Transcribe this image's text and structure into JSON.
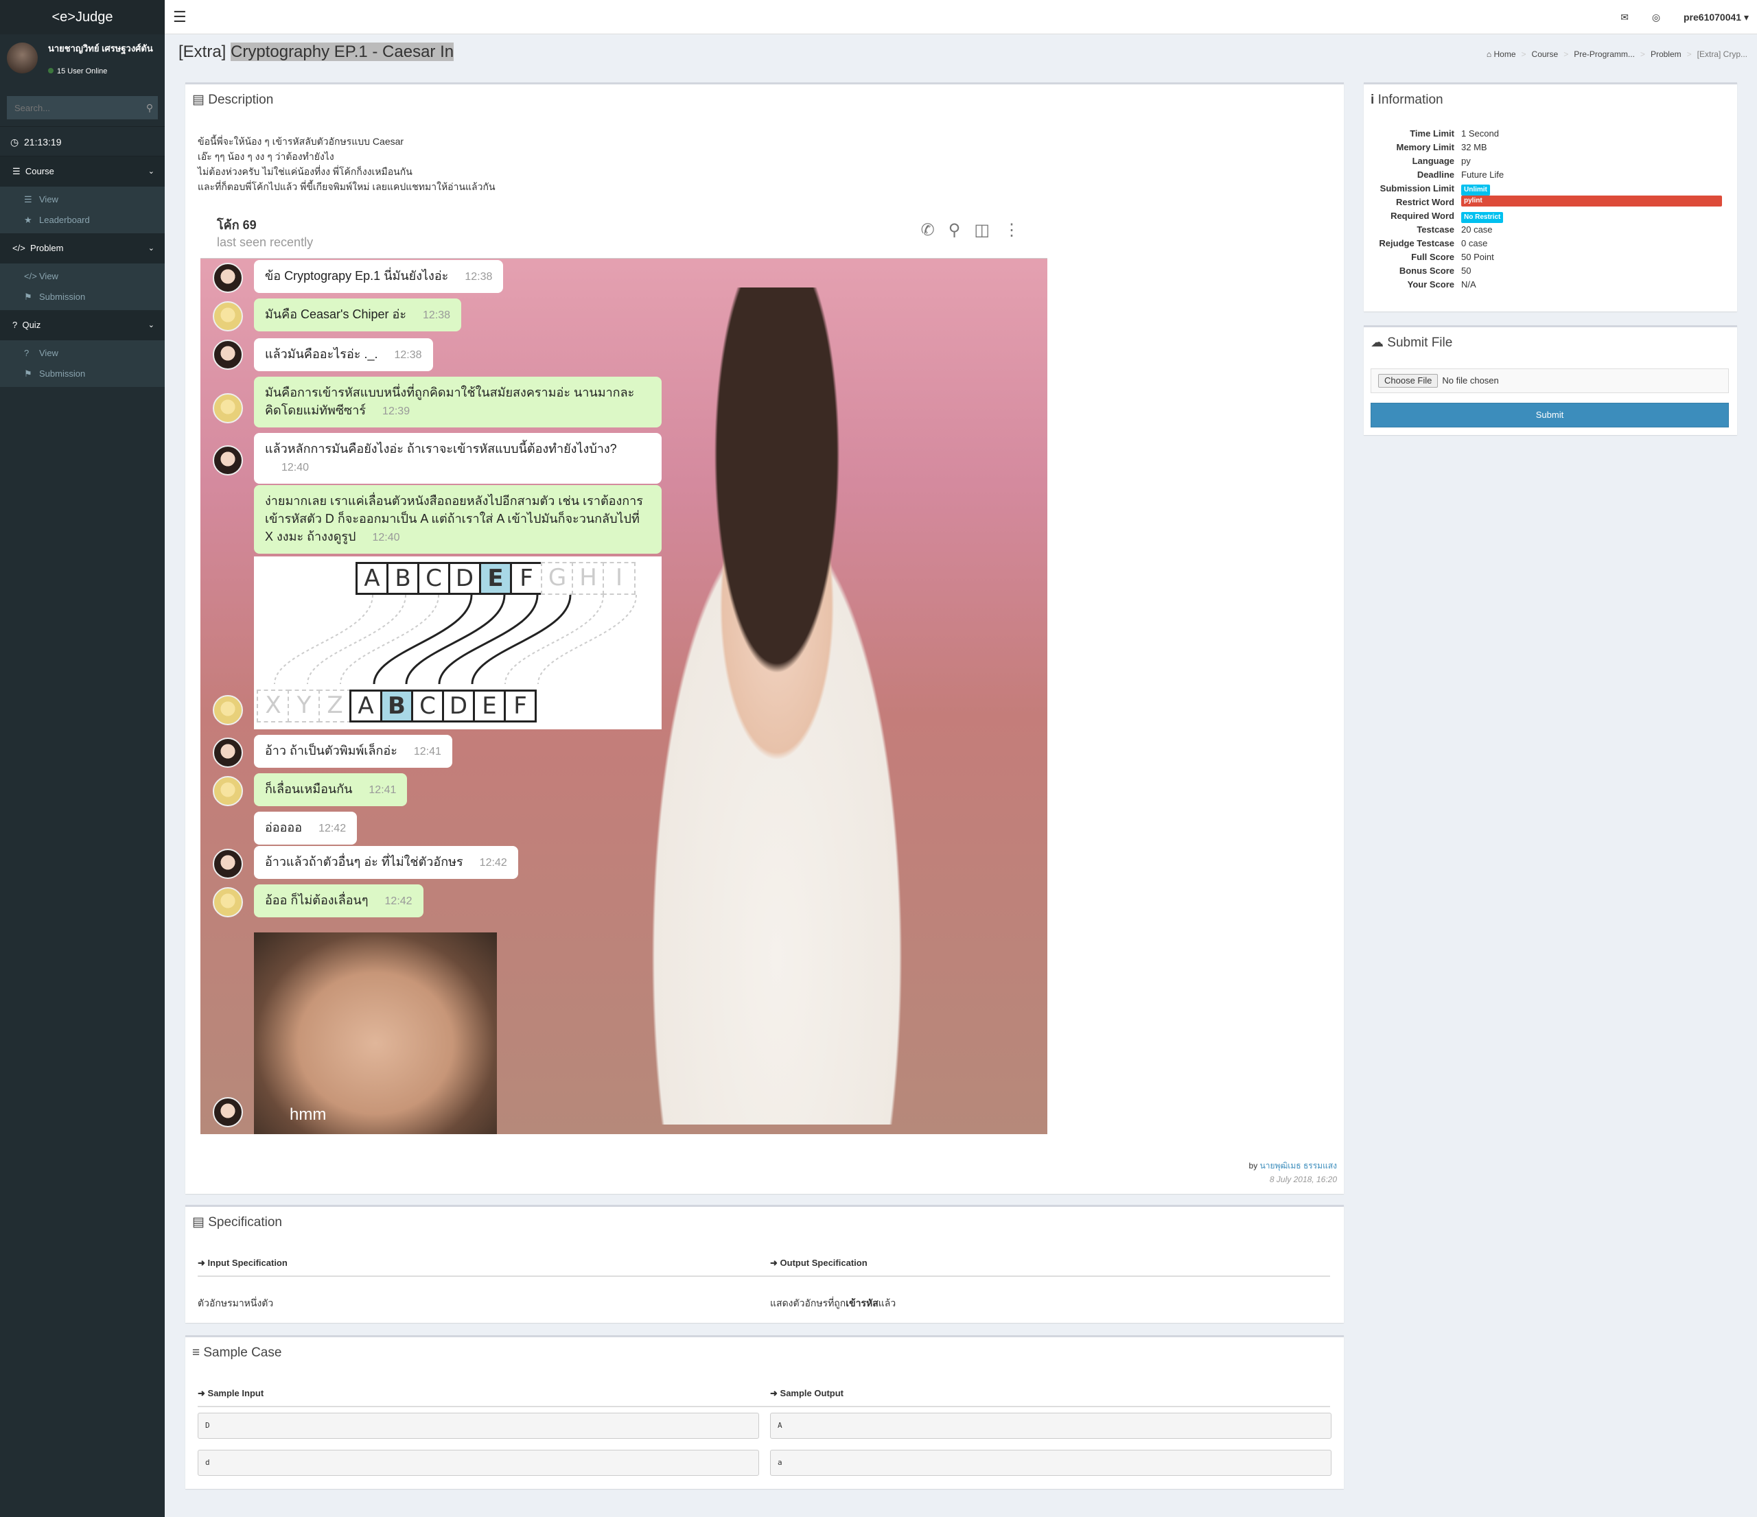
{
  "app": {
    "logo": "<e>Judge"
  },
  "user": {
    "name": "นายชาญวิทย์ เศรษฐวงศ์ตัน",
    "online": "15 User Online",
    "username": "pre61070041"
  },
  "search": {
    "placeholder": "Search..."
  },
  "clock": "21:13:19",
  "menu": {
    "course": {
      "label": "Course",
      "items": [
        {
          "icon": "list-icon",
          "label": "View"
        },
        {
          "icon": "trophy-icon",
          "label": "Leaderboard"
        }
      ]
    },
    "problem": {
      "label": "Problem",
      "items": [
        {
          "icon": "code-icon",
          "label": "View"
        },
        {
          "icon": "flag-icon",
          "label": "Submission"
        }
      ]
    },
    "quiz": {
      "label": "Quiz",
      "items": [
        {
          "icon": "question-icon",
          "label": "View"
        },
        {
          "icon": "flag-icon",
          "label": "Submission"
        }
      ]
    }
  },
  "page": {
    "prefix": "[Extra]",
    "title": "Cryptography EP.1 - Caesar In"
  },
  "breadcrumb": [
    "Home",
    "Course",
    "Pre-Programm...",
    "Problem",
    "[Extra] Cryp..."
  ],
  "description": {
    "heading": "Description",
    "lines": [
      "ข้อนี้พี่จะให้น้อง ๆ เข้ารหัสลับตัวอักษรแบบ Caesar",
      "เอ๊ะ ๆๆ น้อง ๆ งง ๆ ว่าต้องทำยังไง",
      "ไม่ต้องห่วงครับ ไม่ใช่แค่น้องที่งง พี่โค้กก็งงเหมือนกัน",
      "และที่ก็ตอบพี่โค้กไปแล้ว พี่ขี้เกียจพิมพ์ใหม่ เลยแคปแชทมาให้อ่านแล้วกัน"
    ],
    "author_prefix": "by",
    "author": "นายพุฒิเมธ ธรรมแสง",
    "date": "8 July 2018, 16:20"
  },
  "chat": {
    "name": "โค้ก 69",
    "status": "last seen recently",
    "messages": [
      {
        "text": "ข้อ Cryptograpy Ep.1 นี่มันยังไงอ่ะ",
        "time": "12:38"
      },
      {
        "text": "มันคือ Ceasar's Chiper อ่ะ",
        "time": "12:38"
      },
      {
        "text": "แล้วมันคืออะไรอ่ะ ._.",
        "time": "12:38"
      },
      {
        "text": "มันคือการเข้ารหัสแบบหนึ่งที่ถูกคิดมาใช้ในสมัยสงครามอ่ะ นานมากละ คิดโดยแม่ทัพซีซาร์",
        "time": "12:39"
      },
      {
        "text": "แล้วหลักการมันคือยังไงอ่ะ ถ้าเราจะเข้ารหัสแบบนี้ต้องทำยังไงบ้าง?",
        "time": "12:40"
      },
      {
        "text": "ง่ายมากเลย เราแค่เลื่อนตัวหนังสือถอยหลังไปอีกสามตัว เช่น เราต้องการเข้ารหัสตัว D ก็จะออกมาเป็น A แต่ถ้าเราใส่ A เข้าไปมันก็จะวนกลับไปที่ X งงมะ ถ้างงดูรูป",
        "time": "12:40"
      },
      {
        "text": "อ้าว ถ้าเป็นตัวพิมพ์เล็กอ่ะ",
        "time": "12:41"
      },
      {
        "text": "ก็เลื่อนเหมือนกัน",
        "time": "12:41"
      },
      {
        "text": "อ่ออออ",
        "time": "12:42"
      },
      {
        "text": "อ้าวแล้วถ้าตัวอื่นๆ อ่ะ ที่ไม่ใช่ตัวอักษร",
        "time": "12:42"
      },
      {
        "text": "อ้ออ ก็ไม่ต้องเลื่อนๆ",
        "time": "12:42"
      }
    ],
    "top_row": [
      "A",
      "B",
      "C",
      "D",
      "E",
      "F"
    ],
    "top_ghost": [
      "G",
      "H",
      "I"
    ],
    "bottom_ghost": [
      "X",
      "Y",
      "Z"
    ],
    "bottom_row": [
      "A",
      "B",
      "C",
      "D",
      "E",
      "F"
    ],
    "sticker_text": "hmm"
  },
  "info": {
    "heading": "Information",
    "rows": [
      {
        "k": "Time Limit",
        "v": "1 Second"
      },
      {
        "k": "Memory Limit",
        "v": "32 MB"
      },
      {
        "k": "Language",
        "v": "py"
      },
      {
        "k": "Deadline",
        "v": "Future Life"
      },
      {
        "k": "Submission Limit",
        "v": "Unlimit"
      },
      {
        "k": "Restrict Word",
        "v": "pylint"
      },
      {
        "k": "Required Word",
        "v": "No Restrict"
      },
      {
        "k": "Testcase",
        "v": "20 case"
      },
      {
        "k": "Rejudge Testcase",
        "v": "0 case"
      },
      {
        "k": "Full Score",
        "v": "50 Point"
      },
      {
        "k": "Bonus Score",
        "v": "50"
      },
      {
        "k": "Your Score",
        "v": "N/A"
      }
    ],
    "colors": {
      "unlimit": "#00c0ef",
      "restrict": "#dd4b39",
      "required": "#00c0ef"
    }
  },
  "submit": {
    "heading": "Submit File",
    "choose": "Choose File",
    "nofile": "No file chosen",
    "button": "Submit"
  },
  "spec": {
    "heading": "Specification",
    "input_h": "Input Specification",
    "output_h": "Output Specification",
    "input": "ตัวอักษรมาหนึ่งตัว",
    "output_a": "แสดงตัวอักษรที่ถูก",
    "output_b": "เข้ารหัส",
    "output_c": "แล้ว"
  },
  "samples": {
    "heading": "Sample Case",
    "input_h": "Sample Input",
    "output_h": "Sample Output",
    "cases": [
      {
        "in": "D",
        "out": "A"
      },
      {
        "in": "d",
        "out": "a"
      }
    ]
  }
}
